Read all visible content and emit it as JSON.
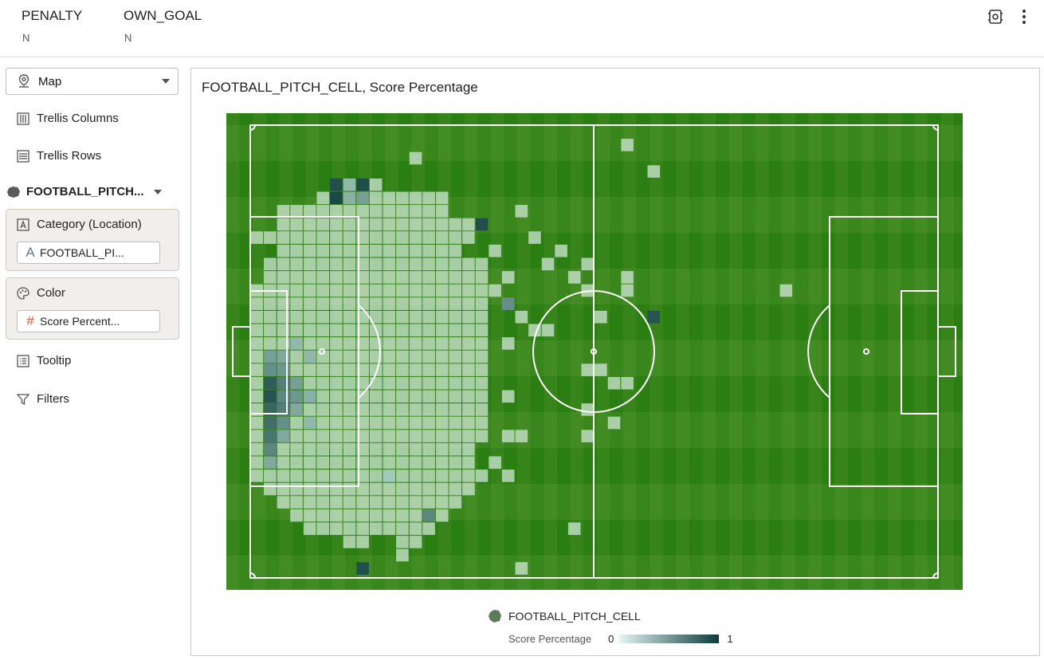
{
  "filters": [
    {
      "name": "PENALTY",
      "value": "N"
    },
    {
      "name": "OWN_GOAL",
      "value": "N"
    }
  ],
  "top_icons": [
    "viz-properties-icon",
    "more-options-icon"
  ],
  "left": {
    "viz_type": "Map",
    "trellis_columns": "Trellis Columns",
    "trellis_rows": "Trellis Rows",
    "layer": "FOOTBALL_PITCH...",
    "category_label": "Category (Location)",
    "category_value": "FOOTBALL_PI...",
    "color_label": "Color",
    "color_value": "Score Percent...",
    "tooltip": "Tooltip",
    "filters": "Filters"
  },
  "chart_title": "FOOTBALL_PITCH_CELL, Score Percentage",
  "legend": {
    "layer_name": "FOOTBALL_PITCH_CELL",
    "measure": "Score Percentage",
    "min": "0",
    "max": "1"
  },
  "colors": {
    "pitch_green": "#2b7e12",
    "low": "#e4f5f3",
    "high": "#0c3b3b"
  },
  "chart_data": {
    "type": "heatmap",
    "title": "FOOTBALL_PITCH_CELL, Score Percentage",
    "grid": {
      "cols": 55,
      "rows": 35
    },
    "color_scale": {
      "min": 0,
      "max": 1
    },
    "cells": [
      [
        1,
        19,
        0.8
      ],
      [
        1,
        20,
        0.85
      ],
      [
        1,
        21,
        0.75
      ],
      [
        1,
        22,
        0.7
      ],
      [
        1,
        23,
        0.65
      ],
      [
        1,
        24,
        0.55
      ],
      [
        1,
        18,
        0.5
      ],
      [
        1,
        17,
        0.4
      ],
      [
        1,
        25,
        0.35
      ],
      [
        2,
        18,
        0.45
      ],
      [
        2,
        19,
        0.6
      ],
      [
        2,
        20,
        0.55
      ],
      [
        2,
        21,
        0.6
      ],
      [
        2,
        22,
        0.5
      ],
      [
        2,
        17,
        0.35
      ],
      [
        2,
        23,
        0.35
      ],
      [
        3,
        19,
        0.4
      ],
      [
        3,
        20,
        0.45
      ],
      [
        3,
        21,
        0.35
      ],
      [
        4,
        20,
        0.3
      ],
      [
        3,
        16,
        0.25
      ],
      [
        4,
        17,
        0.25
      ],
      [
        4,
        22,
        0.25
      ],
      [
        6,
        4,
        0.88
      ],
      [
        7,
        4,
        0.25
      ],
      [
        8,
        4,
        0.9
      ],
      [
        6,
        5,
        0.92
      ],
      [
        7,
        5,
        0.3
      ],
      [
        8,
        5,
        0.4
      ],
      [
        9,
        5,
        0.1
      ],
      [
        8,
        33,
        0.88
      ],
      [
        13,
        29,
        0.55
      ],
      [
        17,
        7,
        0.88
      ],
      [
        19,
        13,
        0.5
      ],
      [
        30,
        14,
        0.85
      ],
      [
        10,
        26,
        0.15
      ],
      [
        12,
        28,
        0.12
      ]
    ]
  }
}
